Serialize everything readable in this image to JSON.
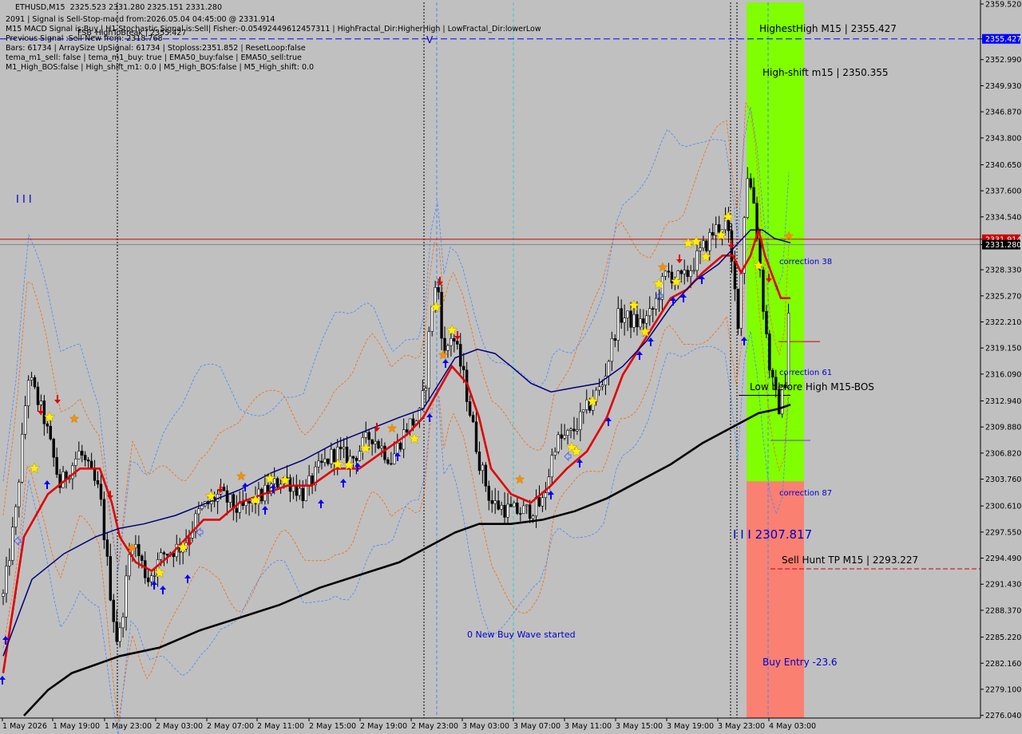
{
  "header": {
    "symbol": "ETHUSD,M15",
    "ohlc": "2325.523 2331.280 2325.151 2331.280",
    "lines": [
      "2091 | Signal is Sell-Stop-macd from:2026.05.04 04:45:00 @ 2331.914",
      "M15 MACD Signal is:Buy | H1 Stochastic Signal is:Sell| Fisher:-0.05492449612457311 | HighFractal_Dir:HigherHigh | LowFractal_Dir:lowerLow",
      "Previous Signal :Sell-New from: 2318.768",
      "Bars: 61734 | ArraySize UpSignal: 61734 | Stoploss:2351.852 | ResetLoop:false",
      "tema_m1_sell: false | tema_m1_buy: true | EMA50_buy:false | EMA50_sell:true",
      "M1_High_BOS:false | High_shift_m1: 0.0 | M5_High_BOS:false | M5_High_shift: 0.0"
    ],
    "overlap_text": "FSB_HighToBreak | 2355.427"
  },
  "colors": {
    "background": "#c0c0c0",
    "candle": "#000000",
    "ema_fast": "#e00000",
    "ema_mid": "#00007a",
    "ema_slow": "#000000",
    "zone_green": "#80ff00",
    "zone_red": "#fa8072",
    "label_blue": "#0000cc",
    "level_blue": "#0000ff",
    "level_red": "#cc0000",
    "star_yellow": "#ffee00",
    "star_orange": "#ff8c00",
    "arrow_blue": "#0000ff",
    "arrow_red": "#e00000"
  },
  "chart_data": {
    "type": "candlestick",
    "symbol": "ETHUSD",
    "timeframe": "M15",
    "y_axis": {
      "range": [
        2276.004,
        2359.52
      ],
      "ticks": [
        "2359.520",
        "2355.427",
        "2352.990",
        "2349.930",
        "2346.870",
        "2343.800",
        "2340.650",
        "2337.600",
        "2334.540",
        "2331.914",
        "2331.280",
        "2328.330",
        "2325.270",
        "2322.210",
        "2319.150",
        "2316.090",
        "2312.940",
        "2309.880",
        "2306.820",
        "2303.760",
        "2300.610",
        "2297.550",
        "2294.490",
        "2291.430",
        "2288.370",
        "2285.220",
        "2282.160",
        "2279.100",
        "2276.040"
      ],
      "highlighted": [
        {
          "value": "2355.427",
          "color": "#0000ff"
        },
        {
          "value": "2331.914",
          "color": "#cc0000"
        },
        {
          "value": "2331.280",
          "color": "#000000"
        }
      ]
    },
    "x_axis": {
      "labels": [
        "1 May 2026",
        "1 May 19:00",
        "1 May 23:00",
        "2 May 03:00",
        "2 May 07:00",
        "2 May 11:00",
        "2 May 15:00",
        "2 May 19:00",
        "2 May 23:00",
        "3 May 03:00",
        "3 May 07:00",
        "3 May 11:00",
        "3 May 15:00",
        "3 May 19:00",
        "3 May 23:00",
        "4 May 03:00"
      ]
    },
    "last_close": 2331.28,
    "levels": [
      {
        "name": "FSB_HighToBreak",
        "value": 2355.427
      },
      {
        "name": "Signal",
        "value": 2331.914
      }
    ],
    "annotations": {
      "highest_high": "HighestHigh    M15 | 2355.427",
      "high_shift": "High-shift m15 | 2350.355",
      "correction_38": "correction 38",
      "correction_61": "correction 61",
      "correction_87": "correction 87",
      "low_before_high": "Low before High    M15-BOS",
      "mid_level": "I I I 2307.817",
      "sell_hunt": "Sell Hunt TP M15 | 2293.227",
      "buy_entry": "Buy Entry -23.6",
      "buy_wave": "0 New Buy Wave started",
      "top_left_marks": "I I I",
      "v_mark": "V"
    },
    "overlays": [
      "EMA fast (red)",
      "EMA mid (navy)",
      "EMA slow (black)",
      "channel bands (orange/blue dashed)"
    ]
  }
}
